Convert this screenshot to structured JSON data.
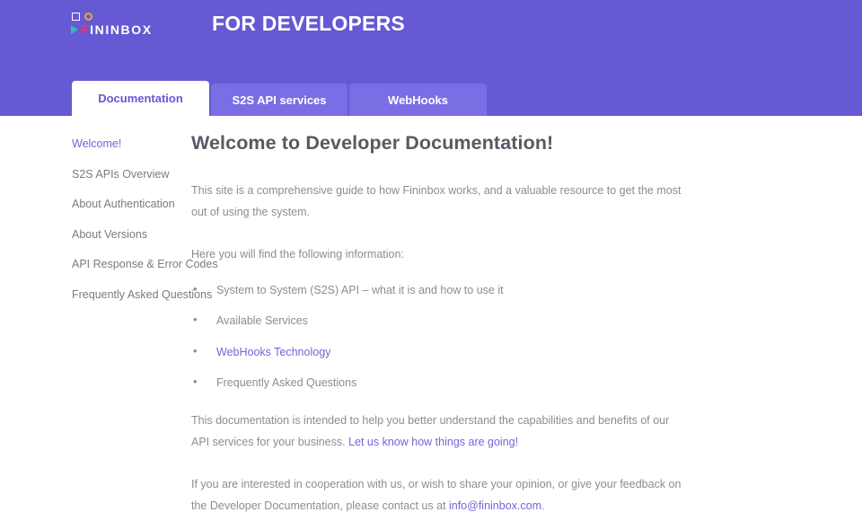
{
  "header": {
    "logo": {
      "square_icon": "square-outline-icon",
      "circle_icon": "circle-outline-icon",
      "triangle_icon": "play-triangle-icon",
      "brand_first_letter": "F",
      "brand_rest": "ININBOX",
      "square_color": "#ffffff",
      "circle_color": "#f0a830",
      "triangle_color": "#2fbfa8",
      "f_color": "#e8337d"
    },
    "title": "FOR DEVELOPERS",
    "background_color": "#6659d4"
  },
  "tabs": [
    {
      "label": "Documentation",
      "active": true
    },
    {
      "label": "S2S API services",
      "active": false
    },
    {
      "label": "WebHooks",
      "active": false
    }
  ],
  "sidebar": {
    "items": [
      {
        "label": "Welcome!",
        "active": true
      },
      {
        "label": "S2S APIs Overview",
        "active": false
      },
      {
        "label": "About Authentication",
        "active": false
      },
      {
        "label": "About Versions",
        "active": false
      },
      {
        "label": "API Response & Error Codes",
        "active": false
      },
      {
        "label": "Frequently Asked Questions",
        "active": false
      }
    ]
  },
  "main": {
    "heading": "Welcome to Developer Documentation!",
    "intro_paragraph": "This site is a comprehensive guide to how Fininbox works, and a valuable resource to get the most out of using the system.",
    "list_lead": "Here you will find the following information:",
    "info_list": [
      {
        "text": "System to System (S2S) API – what it is and how to use it",
        "link": false
      },
      {
        "text": "Available Services",
        "link": false
      },
      {
        "text": "WebHooks Technology",
        "link": true
      },
      {
        "text": "Frequently Asked Questions",
        "link": false
      }
    ],
    "paragraph_2_part1": "This documentation is intended to help you better understand the capabilities and benefits of our API services for your business. ",
    "paragraph_2_link": "Let us know how things are going!",
    "paragraph_3_part1": "If you are interested in cooperation with us, or wish to share your opinion, or give your feedback on the Developer Documentation, please contact us at ",
    "paragraph_3_link": "info@fininbox.com",
    "paragraph_3_part2": "."
  },
  "colors": {
    "brand_purple": "#6659d4",
    "tab_inactive": "#7a6ee5",
    "link_purple": "#7166d8",
    "text_gray": "#8a8d95",
    "heading_gray": "#575a63"
  }
}
